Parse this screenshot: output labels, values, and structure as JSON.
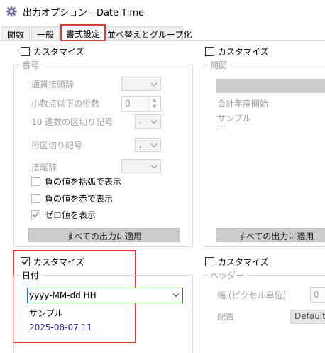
{
  "window": {
    "title": "出力オプション - Date Time"
  },
  "tabs": [
    {
      "label": "関数"
    },
    {
      "label": "一般"
    },
    {
      "label": "書式設定"
    },
    {
      "label": "並べ替えとグループ化"
    }
  ],
  "number_section": {
    "customize_label": "カスタマイズ",
    "group_title": "番号",
    "currency_label": "通貨接頭辞",
    "decimals_label": "小数点以下の桁数",
    "decimals_value": "0",
    "decimal_sep_label": "10 進数の区切り記号",
    "decimal_sep_value": ".",
    "thousands_sep_label": "桁区切り記号",
    "thousands_sep_value": ",",
    "suffix_label": "接尾辞",
    "neg_paren_label": "負の値を括弧で表示",
    "neg_red_label": "負の値を赤で表示",
    "show_zero_label": "ゼロ値を表示",
    "apply_all_label": "すべての出力に適用"
  },
  "period_section": {
    "customize_label": "カスタマイズ",
    "group_title": "期間",
    "fiscal_start_label": "会計年度開始",
    "sample_label": "サンプル",
    "sample_value": "---",
    "apply_all_label": "すべての出力に適用"
  },
  "date_section": {
    "customize_label": "カスタマイズ",
    "group_title": "日付",
    "format_value": "yyyy-MM-dd HH",
    "sample_label": "サンプル",
    "sample_value": "2025-08-07 11"
  },
  "header_section": {
    "customize_label": "カスタマイズ",
    "group_title": "ヘッダー",
    "width_label": "幅 (ピクセル単位)",
    "width_value": "0",
    "align_label": "配置",
    "align_value": "Default"
  },
  "colors": {
    "accent_red": "#e03a3a",
    "sample_blue": "#1d28a8",
    "focus_blue": "#1a73c7"
  }
}
